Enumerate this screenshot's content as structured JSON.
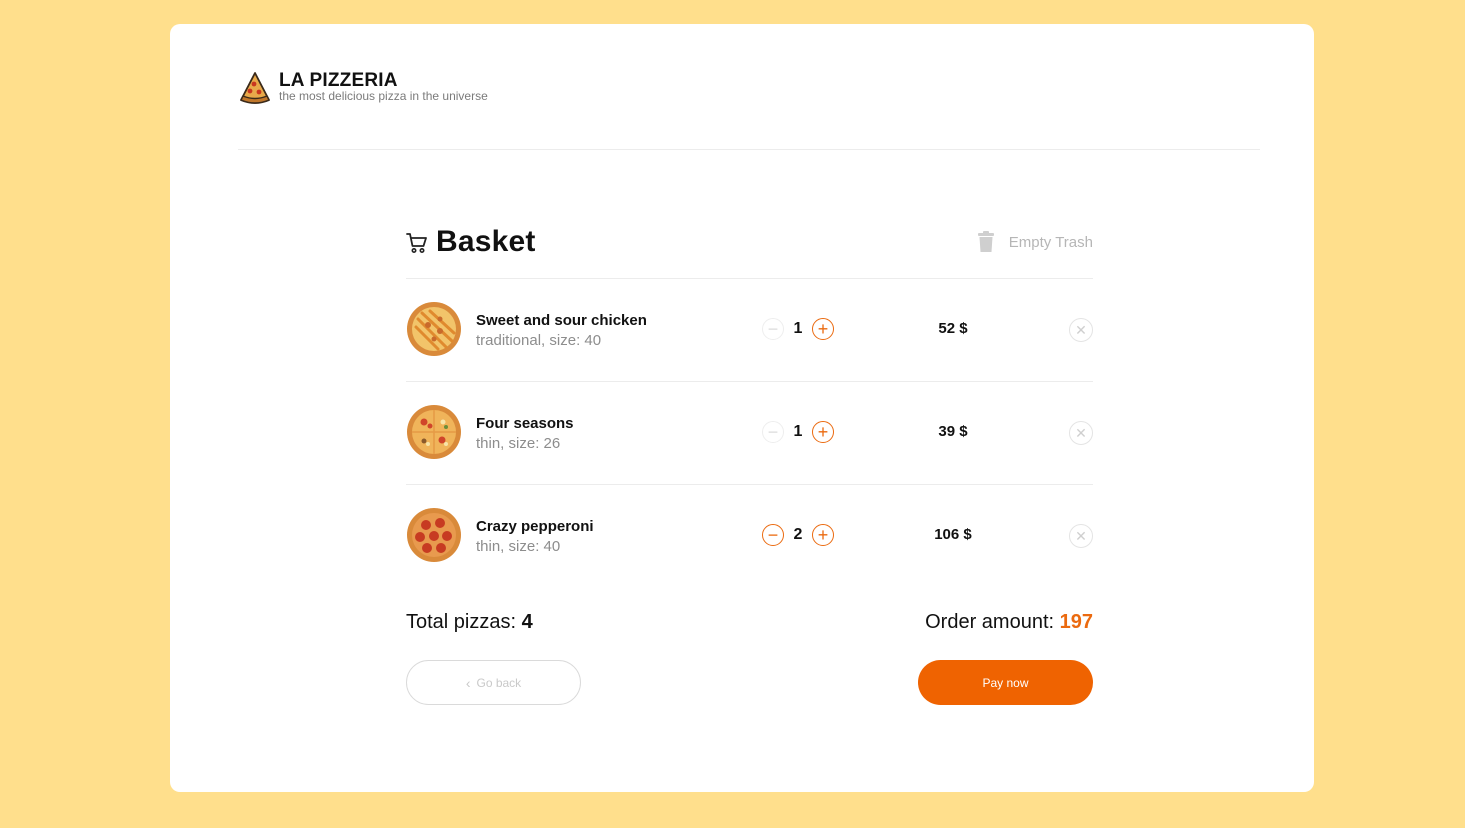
{
  "brand": {
    "title": "LA PIZZERIA",
    "subtitle": "the most delicious pizza in the universe",
    "icon": "pizza-slice-icon"
  },
  "basket": {
    "title": "Basket",
    "title_icon": "cart-icon",
    "empty_trash_label": "Empty Trash",
    "empty_trash_icon": "trash-icon",
    "items": [
      {
        "name": "Sweet and sour chicken",
        "dough": "traditional,",
        "size": "size: 40",
        "quantity": "1",
        "price": "52 $",
        "minus_enabled": false
      },
      {
        "name": "Four seasons",
        "dough": "thin,",
        "size": "size: 26",
        "quantity": "1",
        "price": "39 $",
        "minus_enabled": false
      },
      {
        "name": "Crazy pepperoni",
        "dough": "thin,",
        "size": "size: 40",
        "quantity": "2",
        "price": "106 $",
        "minus_enabled": true
      }
    ],
    "total_pizzas_label": "Total pizzas:",
    "total_pizzas_value": "4",
    "order_amount_label": "Order amount:",
    "order_amount_value": "197",
    "go_back_label": "Go back",
    "pay_now_label": "Pay now"
  },
  "colors": {
    "page_background": "#FFDF8C",
    "accent": "#EF6301",
    "text": "#111111",
    "muted": "#8D8D8D"
  }
}
